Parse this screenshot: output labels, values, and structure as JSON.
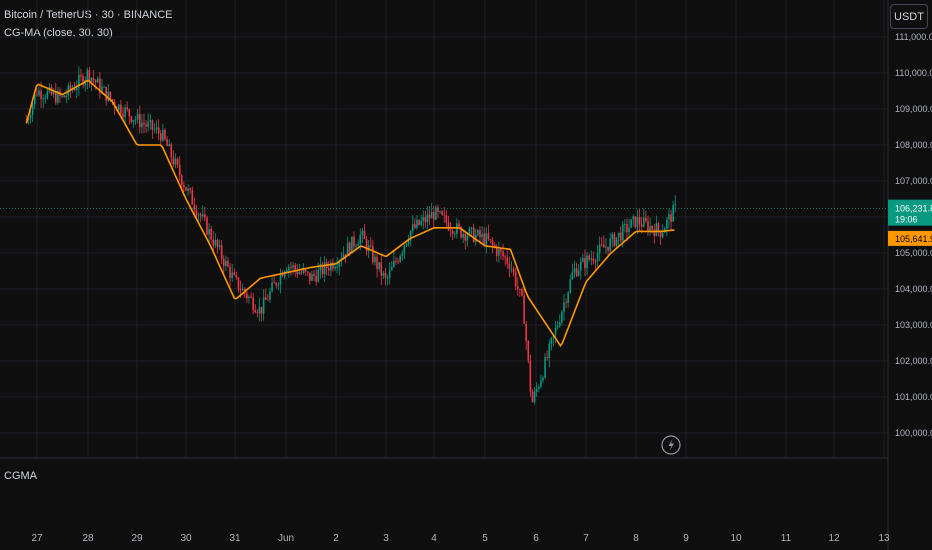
{
  "header": {
    "symbol_title": "Bitcoin / TetherUS · 30 · BINANCE",
    "indicator_legend": "CG-MA (close, 30, 30)",
    "currency_button": "USDT"
  },
  "lower_pane": {
    "label": "CGMA"
  },
  "price_scale": {
    "ticks": [
      "111,000.00",
      "110,000.00",
      "109,000.00",
      "108,000.00",
      "107,000.00",
      "105,000.00",
      "104,000.00",
      "103,000.00",
      "102,000.00",
      "101,000.00",
      "100,000.00"
    ],
    "last_price_label": "106,231.81",
    "countdown_label": "19:06",
    "ma_label": "105,641.90"
  },
  "time_scale": {
    "labels": [
      "27",
      "28",
      "29",
      "30",
      "31",
      "Jun",
      "2",
      "3",
      "4",
      "5",
      "6",
      "7",
      "8",
      "9",
      "10",
      "11",
      "12",
      "13"
    ]
  },
  "colors": {
    "background": "#0f0f0f",
    "up_candle": "#089981",
    "down_candle": "#f23645",
    "ma_line": "#ff9800",
    "last_price_badge": "#089981",
    "ma_badge": "#ff9800"
  },
  "icons": {
    "replay": "lightning-icon"
  },
  "chart_data": {
    "type": "candlestick",
    "interval": "30m",
    "ylim": [
      99700,
      111300
    ],
    "x_labels": [
      "27",
      "28",
      "29",
      "30",
      "31",
      "Jun",
      "2",
      "3",
      "4",
      "5",
      "6",
      "7",
      "8",
      "9",
      "10",
      "11",
      "12",
      "13"
    ],
    "price_path": [
      {
        "date": "May 26 19:00",
        "price": 108700
      },
      {
        "date": "May 27 00:00",
        "price": 109500
      },
      {
        "date": "May 27 12:00",
        "price": 109300
      },
      {
        "date": "May 28 00:00",
        "price": 110000
      },
      {
        "date": "May 28 12:00",
        "price": 109200
      },
      {
        "date": "May 29 00:00",
        "price": 108700
      },
      {
        "date": "May 29 12:00",
        "price": 108300
      },
      {
        "date": "May 30 00:00",
        "price": 106800
      },
      {
        "date": "May 30 12:00",
        "price": 105500
      },
      {
        "date": "May 31 00:00",
        "price": 104200
      },
      {
        "date": "May 31 12:00",
        "price": 103400
      },
      {
        "date": "Jun 1 00:00",
        "price": 104700
      },
      {
        "date": "Jun 1 12:00",
        "price": 104300
      },
      {
        "date": "Jun 2 00:00",
        "price": 104800
      },
      {
        "date": "Jun 2 12:00",
        "price": 105500
      },
      {
        "date": "Jun 3 00:00",
        "price": 104200
      },
      {
        "date": "Jun 3 12:00",
        "price": 105600
      },
      {
        "date": "Jun 4 00:00",
        "price": 106100
      },
      {
        "date": "Jun 4 12:00",
        "price": 105600
      },
      {
        "date": "Jun 5 00:00",
        "price": 105400
      },
      {
        "date": "Jun 5 12:00",
        "price": 104700
      },
      {
        "date": "Jun 5 18:00",
        "price": 103500
      },
      {
        "date": "Jun 5 22:00",
        "price": 100800
      },
      {
        "date": "Jun 6 06:00",
        "price": 102200
      },
      {
        "date": "Jun 6 18:00",
        "price": 104500
      },
      {
        "date": "Jun 7 12:00",
        "price": 105300
      },
      {
        "date": "Jun 8 00:00",
        "price": 105900
      },
      {
        "date": "Jun 8 12:00",
        "price": 105600
      },
      {
        "date": "Jun 8 19:00",
        "price": 106231.81
      }
    ],
    "ma_series": [
      {
        "date": "May 26 19:00",
        "price": 108600
      },
      {
        "date": "May 27 00:00",
        "price": 109700
      },
      {
        "date": "May 27 12:00",
        "price": 109400
      },
      {
        "date": "May 28 00:00",
        "price": 109800
      },
      {
        "date": "May 28 12:00",
        "price": 109200
      },
      {
        "date": "May 29 00:00",
        "price": 108000
      },
      {
        "date": "May 29 12:00",
        "price": 108000
      },
      {
        "date": "May 30 00:00",
        "price": 106500
      },
      {
        "date": "May 30 12:00",
        "price": 105200
      },
      {
        "date": "May 31 00:00",
        "price": 103700
      },
      {
        "date": "May 31 12:00",
        "price": 104300
      },
      {
        "date": "Jun 1 12:00",
        "price": 104600
      },
      {
        "date": "Jun 2 00:00",
        "price": 104700
      },
      {
        "date": "Jun 2 12:00",
        "price": 105200
      },
      {
        "date": "Jun 3 00:00",
        "price": 104900
      },
      {
        "date": "Jun 3 12:00",
        "price": 105400
      },
      {
        "date": "Jun 4 00:00",
        "price": 105700
      },
      {
        "date": "Jun 4 12:00",
        "price": 105700
      },
      {
        "date": "Jun 5 00:00",
        "price": 105200
      },
      {
        "date": "Jun 5 12:00",
        "price": 105100
      },
      {
        "date": "Jun 5 20:00",
        "price": 103800
      },
      {
        "date": "Jun 6 12:00",
        "price": 102400
      },
      {
        "date": "Jun 7 00:00",
        "price": 104200
      },
      {
        "date": "Jun 7 12:00",
        "price": 105000
      },
      {
        "date": "Jun 8 00:00",
        "price": 105600
      },
      {
        "date": "Jun 8 12:00",
        "price": 105600
      },
      {
        "date": "Jun 8 19:00",
        "price": 105641.9
      }
    ],
    "last_price": 106231.81,
    "ma_last": 105641.9
  }
}
